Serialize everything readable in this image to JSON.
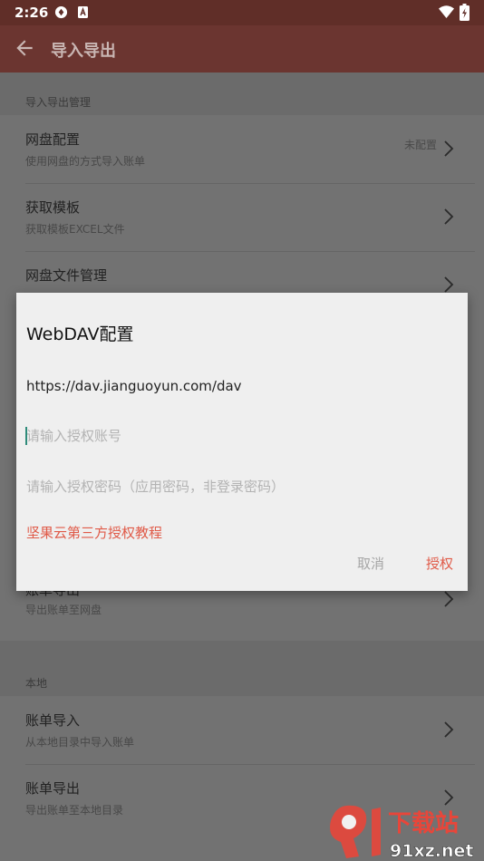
{
  "status_bar": {
    "time": "2:26",
    "icons": [
      "sync-icon",
      "app-notification-icon",
      "wifi-icon",
      "battery-charging-icon"
    ]
  },
  "app_bar": {
    "title": "导入导出",
    "back_icon": "arrow-left-icon"
  },
  "sections": [
    {
      "header": "导入导出管理",
      "items": [
        {
          "title": "网盘配置",
          "subtitle": "使用网盘的方式导入账单",
          "value": "未配置"
        },
        {
          "title": "获取模板",
          "subtitle": "获取模板EXCEL文件",
          "value": ""
        },
        {
          "title": "网盘文件管理",
          "subtitle": "",
          "value": ""
        },
        {
          "title": "账单导出",
          "subtitle": "导出账单至网盘",
          "value": ""
        }
      ]
    },
    {
      "header": "本地",
      "items": [
        {
          "title": "账单导入",
          "subtitle": "从本地目录中导入账单",
          "value": ""
        },
        {
          "title": "账单导出",
          "subtitle": "导出账单至本地目录",
          "value": ""
        }
      ]
    }
  ],
  "dialog": {
    "title": "WebDAV配置",
    "url": "https://dav.jianguoyun.com/dav",
    "account_placeholder": "请输入授权账号",
    "account_value": "",
    "password_placeholder": "请输入授权密码（应用密码，非登录密码）",
    "password_value": "",
    "tutorial_link": "坚果云第三方授权教程",
    "cancel_label": "取消",
    "confirm_label": "授权"
  },
  "watermark": {
    "brand_text": "下载站",
    "domain_text": "91xz.net"
  },
  "colors": {
    "accent": "#e05a48",
    "app_bar": "#6b3530",
    "status_bar": "#602e28",
    "dialog_bg": "#efefef",
    "scrim_bg": "#6b6b6b"
  }
}
